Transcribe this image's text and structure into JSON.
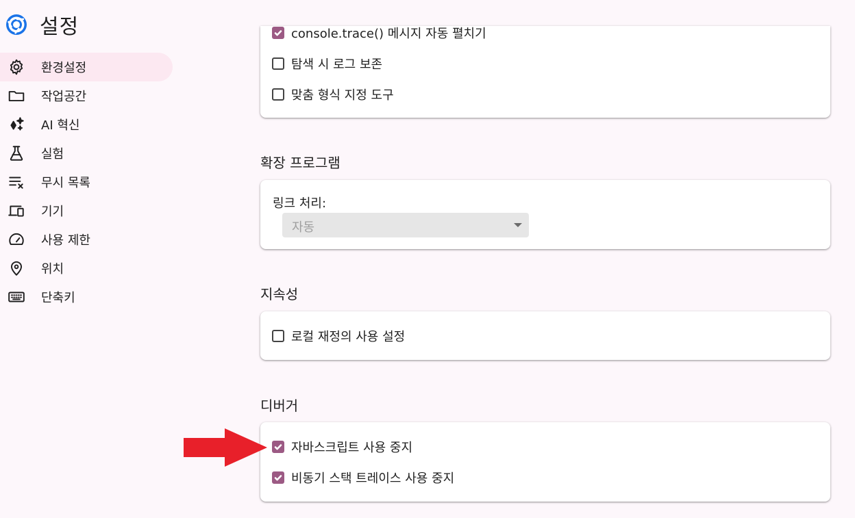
{
  "header": {
    "title": "설정",
    "logo_icon": "chrome-logo-icon"
  },
  "sidebar": {
    "items": [
      {
        "label": "환경설정",
        "icon": "gear-icon",
        "active": true
      },
      {
        "label": "작업공간",
        "icon": "folder-icon",
        "active": false
      },
      {
        "label": "AI 혁신",
        "icon": "sparkle-icon",
        "active": false
      },
      {
        "label": "실험",
        "icon": "flask-icon",
        "active": false
      },
      {
        "label": "무시 목록",
        "icon": "ignore-list-icon",
        "active": false
      },
      {
        "label": "기기",
        "icon": "devices-icon",
        "active": false
      },
      {
        "label": "사용 제한",
        "icon": "speedometer-icon",
        "active": false
      },
      {
        "label": "위치",
        "icon": "location-pin-icon",
        "active": false
      },
      {
        "label": "단축키",
        "icon": "keyboard-icon",
        "active": false
      }
    ]
  },
  "console_card": {
    "items": [
      {
        "label": "console.trace() 메시지 자동 펼치기",
        "checked": true
      },
      {
        "label": "탐색 시 로그 보존",
        "checked": false
      },
      {
        "label": "맞춤 형식 지정 도구",
        "checked": false
      }
    ]
  },
  "extensions": {
    "title": "확장 프로그램",
    "link_label": "링크 처리:",
    "select_value": "자동"
  },
  "persistence": {
    "title": "지속성",
    "items": [
      {
        "label": "로컬 재정의 사용 설정",
        "checked": false
      }
    ]
  },
  "debugger": {
    "title": "디버거",
    "items": [
      {
        "label": "자바스크립트 사용 중지",
        "checked": true
      },
      {
        "label": "비동기 스택 트레이스 사용 중지",
        "checked": true
      }
    ]
  },
  "colors": {
    "accent": "#9c5a84",
    "active_nav_bg": "#fce8f1",
    "annotation_arrow": "#e8202a"
  }
}
